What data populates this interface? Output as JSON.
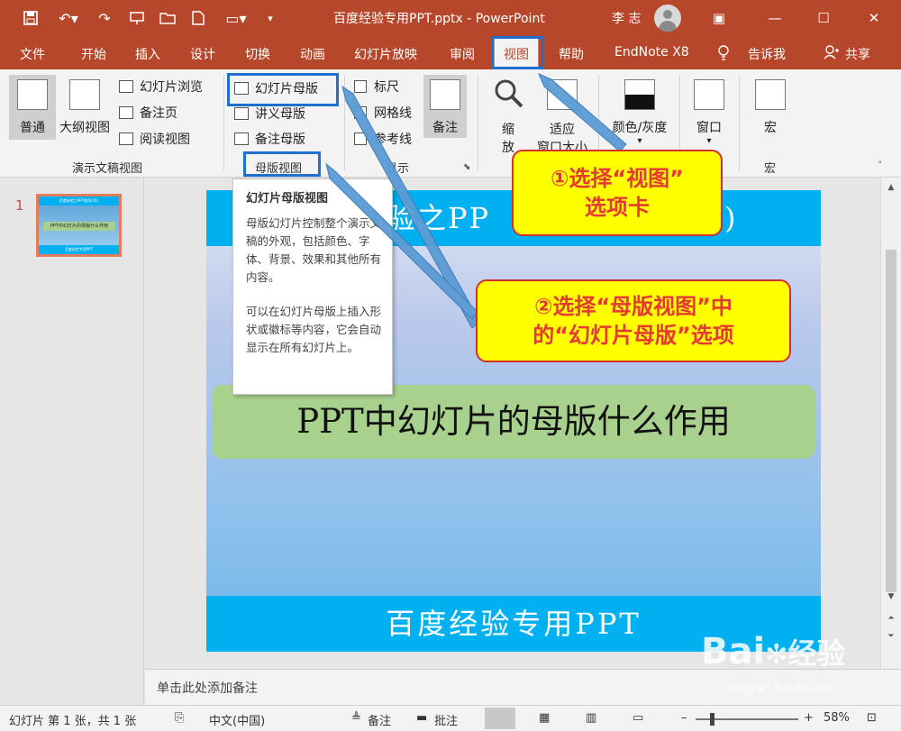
{
  "titlebar": {
    "title": "百度经验专用PPT.pptx  -  PowerPoint",
    "user": "李 志",
    "qa_icons": [
      "save-icon",
      "undo-icon",
      "redo-icon",
      "present-icon",
      "open-icon",
      "new-icon",
      "shapes-icon",
      "customize-icon"
    ]
  },
  "tabs": [
    "文件",
    "开始",
    "插入",
    "设计",
    "切换",
    "动画",
    "幻灯片放映",
    "审阅",
    "视图",
    "帮助",
    "EndNote X8",
    "告诉我",
    "共享"
  ],
  "ribbon": {
    "presentation_views": {
      "normal": "普通",
      "outline": "大纲视图",
      "sorter": "幻灯片浏览",
      "notes_page": "备注页",
      "reading": "阅读视图",
      "group_label": "演示文稿视图"
    },
    "master_views": {
      "slide_master": "幻灯片母版",
      "handout_master": "讲义母版",
      "notes_master": "备注母版",
      "group_label": "母版视图"
    },
    "show": {
      "ruler": "标尺",
      "gridlines": "网格线",
      "guides": "参考线",
      "notes": "备注",
      "group_label": "显示"
    },
    "zoom": {
      "zoom": [
        "缩",
        "放"
      ],
      "fit": [
        "适应",
        "窗口大小"
      ]
    },
    "color": "颜色/灰度",
    "window": "窗口",
    "macros": "宏",
    "macros_group": "宏"
  },
  "thumbnail": {
    "number": "1",
    "top": "百度经验之PPT使用(16)",
    "mid": "PPT中幻灯片的母版什么作用",
    "bot": "百度经验专用PPT"
  },
  "slide": {
    "top_text": "验之PP",
    "top_right": ")",
    "mid_text": "PPT中幻灯片的母版什么作用",
    "bottom_text": "百度经验专用PPT"
  },
  "tooltip": {
    "title": "幻灯片母版视图",
    "body": "母版幻灯片控制整个演示文稿的外观，包括颜色、字体、背景、效果和其他所有内容。",
    "body2": "可以在幻灯片母版上插入形状或徽标等内容，它会自动显示在所有幻灯片上。"
  },
  "callouts": {
    "c1": [
      "①选择“视图”",
      "选项卡"
    ],
    "c2": [
      "②选择“母版视图”中",
      "的“幻灯片母版”选项"
    ]
  },
  "notes_placeholder": "单击此处添加备注",
  "status": {
    "slide_info": "幻灯片 第 1 张，共 1 张",
    "language": "中文(中国)",
    "notes": "备注",
    "comments": "批注",
    "zoom": "58%"
  },
  "watermark": {
    "brand": "Bai",
    "brand2": "经验",
    "url": "jingyan.baidu.com"
  },
  "colors": {
    "accent": "#b7472a",
    "highlight": "#1f6fd1",
    "callout_fill": "#ffff00",
    "callout_border": "#d32f2f"
  }
}
